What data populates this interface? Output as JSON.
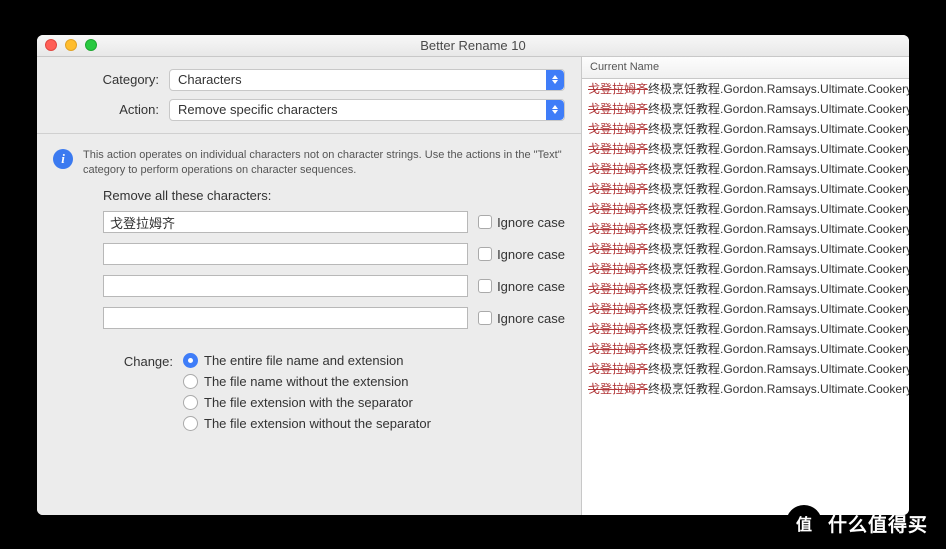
{
  "window": {
    "title": "Better Rename 10"
  },
  "dropdowns": {
    "category_label": "Category:",
    "category_value": "Characters",
    "action_label": "Action:",
    "action_value": "Remove specific characters"
  },
  "info": {
    "text": "This action operates on individual characters not on character strings. Use the actions in the \"Text\" category to perform operations on character sequences."
  },
  "fields": {
    "title": "Remove all these characters:",
    "rows": [
      {
        "value": "戈登拉姆齐",
        "checkbox_label": "Ignore case"
      },
      {
        "value": "",
        "checkbox_label": "Ignore case"
      },
      {
        "value": "",
        "checkbox_label": "Ignore case"
      },
      {
        "value": "",
        "checkbox_label": "Ignore case"
      }
    ]
  },
  "change": {
    "label": "Change:",
    "options": [
      {
        "label": "The entire file name and extension",
        "selected": true
      },
      {
        "label": "The file name without the extension",
        "selected": false
      },
      {
        "label": "The file extension with the separator",
        "selected": false
      },
      {
        "label": "The file extension without the separator",
        "selected": false
      }
    ]
  },
  "filelist": {
    "header": "Current Name",
    "strike_part": "戈登拉姆齐",
    "rest_part": "终极烹饪教程.Gordon.Ramsays.Ultimate.Cookery.",
    "row_count": 16
  },
  "watermark": {
    "circle": "值",
    "text": "什么值得买"
  }
}
